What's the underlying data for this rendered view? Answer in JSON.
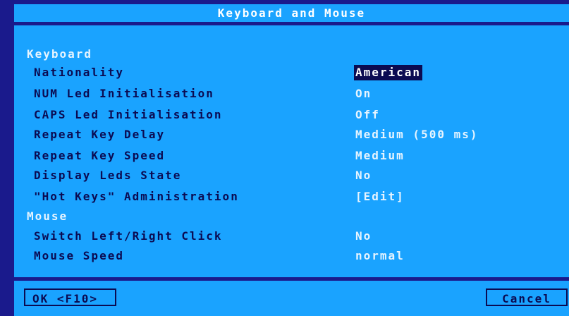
{
  "window": {
    "title": "Keyboard and Mouse"
  },
  "sections": {
    "keyboard": "Keyboard",
    "mouse": "Mouse"
  },
  "keyboard_rows": [
    {
      "label": "Nationality",
      "value": "American"
    },
    {
      "label": "NUM Led Initialisation",
      "value": "On"
    },
    {
      "label": "CAPS Led Initialisation",
      "value": "Off"
    },
    {
      "label": "Repeat Key Delay",
      "value": "Medium (500 ms)"
    },
    {
      "label": "Repeat Key Speed",
      "value": "Medium"
    },
    {
      "label": "Display Leds State",
      "value": "No"
    },
    {
      "label": "\"Hot Keys\" Administration",
      "value": "[Edit]"
    }
  ],
  "mouse_rows": [
    {
      "label": "Switch Left/Right Click",
      "value": "No"
    },
    {
      "label": "Mouse Speed",
      "value": "normal"
    }
  ],
  "buttons": {
    "ok": "OK <F10>",
    "cancel": "Cancel"
  },
  "colors": {
    "outer_background": "#1a1a8c",
    "panel_background": "#1aa3ff",
    "label_text": "#0b0b52",
    "value_text": "#e6f4ff",
    "selected_background": "#0b0b52"
  }
}
